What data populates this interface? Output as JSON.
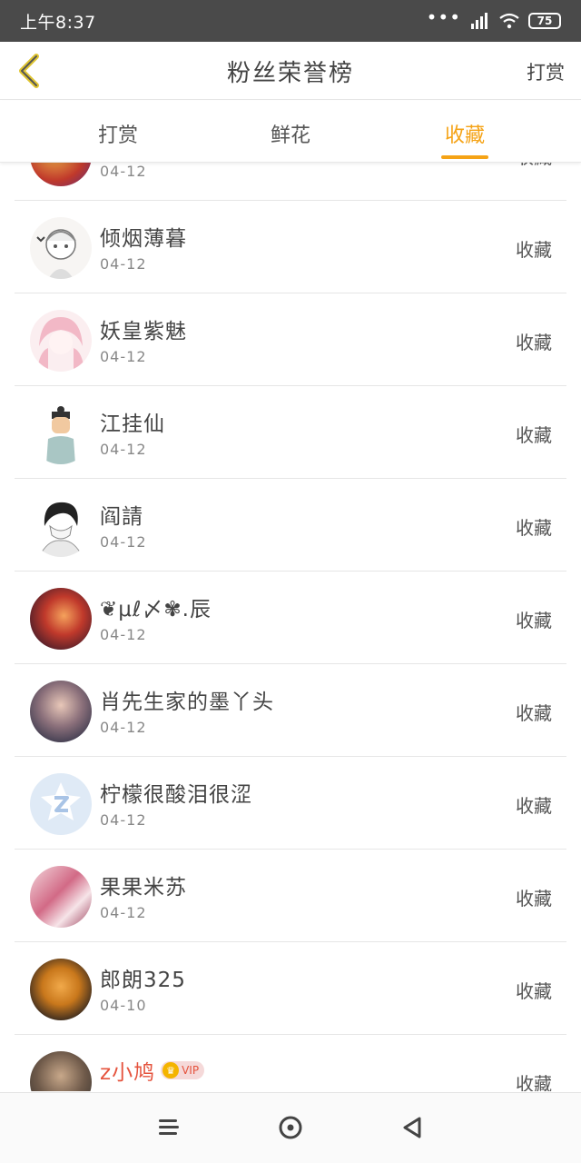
{
  "status": {
    "time": "上午8:37",
    "battery": "75",
    "icons": [
      "more-dots-icon",
      "signal-icon",
      "wifi-icon",
      "battery-icon"
    ]
  },
  "header": {
    "back_icon": "chevron-left-icon",
    "title": "粉丝荣誉榜",
    "action": "打赏"
  },
  "tabs": [
    {
      "label": "打赏",
      "active": false
    },
    {
      "label": "鲜花",
      "active": false
    },
    {
      "label": "收藏",
      "active": true
    }
  ],
  "accent_color": "#f5a316",
  "list": [
    {
      "name": "",
      "date": "04-12",
      "action": "收藏"
    },
    {
      "name": "倾烟薄暮",
      "date": "04-12",
      "action": "收藏"
    },
    {
      "name": "妖皇紫魅",
      "date": "04-12",
      "action": "收藏"
    },
    {
      "name": "江挂仙",
      "date": "04-12",
      "action": "收藏"
    },
    {
      "name": "阎請",
      "date": "04-12",
      "action": "收藏"
    },
    {
      "name": "❦μℓ〆✾.辰",
      "date": "04-12",
      "action": "收藏"
    },
    {
      "name": "肖先生家的墨丫头",
      "date": "04-12",
      "action": "收藏"
    },
    {
      "name": "柠檬很酸泪很涩",
      "date": "04-12",
      "action": "收藏"
    },
    {
      "name": "果果米苏",
      "date": "04-12",
      "action": "收藏"
    },
    {
      "name": "郎朗325",
      "date": "04-10",
      "action": "收藏"
    },
    {
      "name": "z小鸠",
      "date": "",
      "action": "收藏",
      "vip": "VIP"
    }
  ],
  "navbar": [
    "menu-icon",
    "home-circle-icon",
    "back-triangle-icon"
  ]
}
